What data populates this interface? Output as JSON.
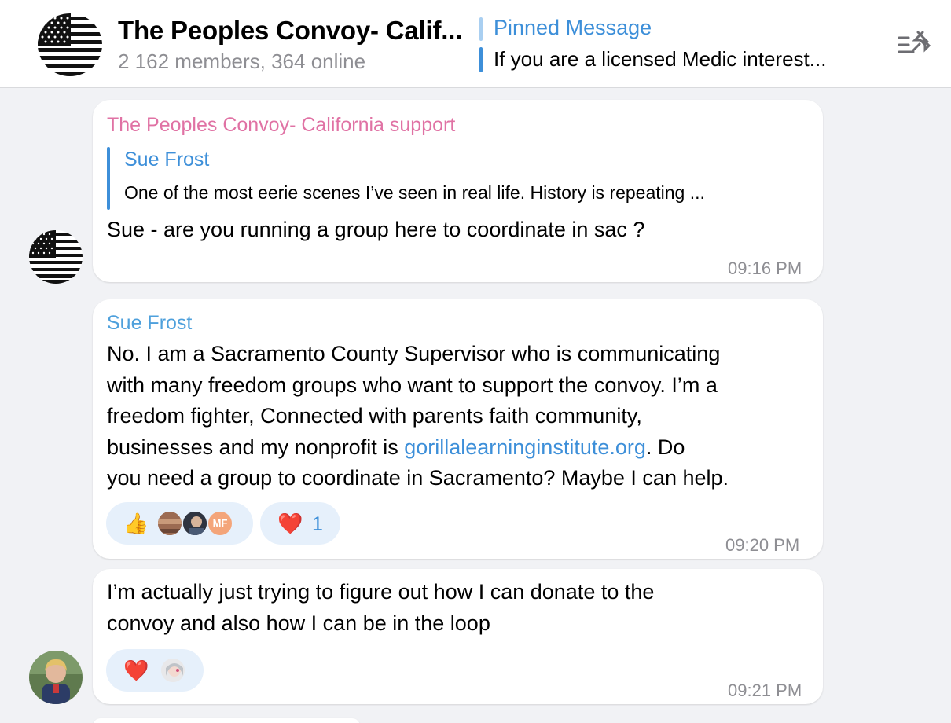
{
  "header": {
    "title": "The Peoples Convoy- Calif...",
    "subtitle": "2 162 members, 364 online",
    "pinned_title": "Pinned Message",
    "pinned_text": "If you are a licensed Medic interest..."
  },
  "messages": [
    {
      "sender": "The Peoples Convoy- California support",
      "reply_to": {
        "name": "Sue Frost",
        "text": "One of the most eerie scenes I’ve seen in real life. History is repeating ..."
      },
      "text": "Sue - are you running a group here to coordinate in sac ?",
      "time": "09:16 PM"
    },
    {
      "sender": "Sue Frost",
      "lines": [
        "No. I am a Sacramento County Supervisor who is communicating",
        "with many freedom groups who want to support the convoy. I’m a",
        "freedom fighter, Connected with parents faith community,"
      ],
      "line4_before": "businesses and my nonprofit is ",
      "link": "gorillalearninginstitute.org",
      "line4_after": ". Do",
      "line5": "you need a group to coordinate in Sacramento? Maybe I can help.",
      "reactions": [
        {
          "emoji": "👍",
          "avatars": [
            "",
            "",
            "MF"
          ]
        },
        {
          "emoji": "❤️",
          "count": "1"
        }
      ],
      "time": "09:20 PM"
    },
    {
      "lines": [
        "I’m actually just trying to figure out how I can donate to the",
        "convoy and also how I can be in the loop"
      ],
      "reactions": [
        {
          "emoji": "❤️"
        }
      ],
      "time": "09:21 PM"
    }
  ],
  "colors": {
    "accent": "#3d8fd9",
    "sender_pink": "#e072a4",
    "sender_blue": "#4ea0dc",
    "background": "#f1f2f5"
  },
  "icons": [
    "flag-avatar-icon",
    "pinned-list-icon",
    "thumbs-up-icon",
    "heart-icon"
  ]
}
